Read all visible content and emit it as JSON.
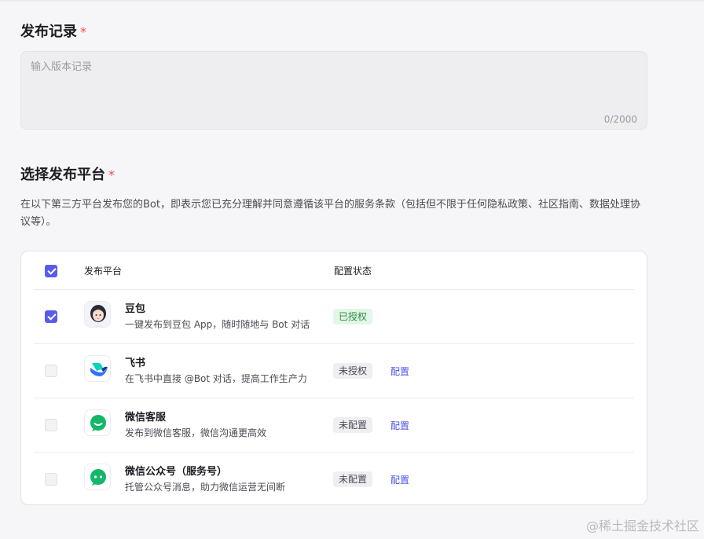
{
  "release_notes": {
    "title": "发布记录",
    "required_mark": "*",
    "placeholder": "输入版本记录",
    "value": "",
    "counter": "0/2000"
  },
  "platform_section": {
    "title": "选择发布平台",
    "required_mark": "*",
    "description": "在以下第三方平台发布您的Bot，即表示您已充分理解并同意遵循该平台的服务条款（包括但不限于任何隐私政策、社区指南、数据处理协议等）。",
    "table": {
      "header": {
        "platform": "发布平台",
        "status": "配置状态",
        "select_all_checked": true
      },
      "rows": [
        {
          "name": "豆包",
          "desc": "一键发布到豆包 App，随时随地与 Bot 对话",
          "status": "已授权",
          "status_type": "ok",
          "checked": true,
          "action": "",
          "icon": "doubao-avatar-icon"
        },
        {
          "name": "飞书",
          "desc": "在飞书中直接 @Bot 对话，提高工作生产力",
          "status": "未授权",
          "status_type": "no",
          "checked": false,
          "action": "配置",
          "icon": "feishu-logo-icon"
        },
        {
          "name": "微信客服",
          "desc": "发布到微信客服，微信沟通更高效",
          "status": "未配置",
          "status_type": "no",
          "checked": false,
          "action": "配置",
          "icon": "wechat-service-icon"
        },
        {
          "name": "微信公众号（服务号）",
          "desc": "托管公众号消息，助力微信运营无间断",
          "status": "未配置",
          "status_type": "no",
          "checked": false,
          "action": "配置",
          "icon": "wechat-official-icon"
        }
      ]
    }
  },
  "watermark": "@稀土掘金技术社区",
  "colors": {
    "accent": "#5a5ce8",
    "link": "#4d53e8",
    "required": "#f54a45",
    "wechat_green": "#1aad19"
  }
}
